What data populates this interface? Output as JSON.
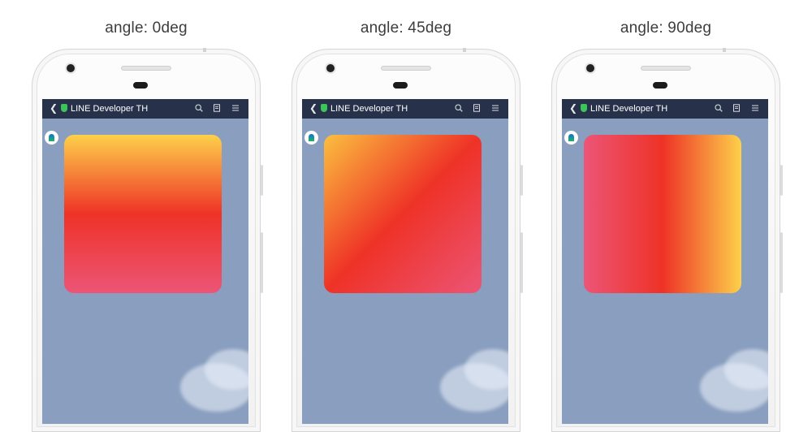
{
  "panels": [
    {
      "caption": "angle: 0deg",
      "app_title": "LINE Developer TH",
      "gradient": {
        "angle_deg": 0,
        "stops": [
          "#fdd04a",
          "#ee3227",
          "#ec5576"
        ]
      }
    },
    {
      "caption": "angle: 45deg",
      "app_title": "LINE Developer TH",
      "gradient": {
        "angle_deg": 45,
        "stops": [
          "#fbbf3f",
          "#ee3227",
          "#ec5576"
        ]
      }
    },
    {
      "caption": "angle: 90deg",
      "app_title": "LINE Developer TH",
      "gradient": {
        "angle_deg": 90,
        "stops": [
          "#ec5576",
          "#ee3227",
          "#fdd04a"
        ]
      }
    }
  ],
  "icons": {
    "back": "chevron-left-icon",
    "verified": "shield-icon",
    "search": "search-icon",
    "notes": "notes-icon",
    "menu": "menu-icon"
  },
  "colors": {
    "navbar": "#27314a",
    "chat_background": "#8a9ebf"
  }
}
